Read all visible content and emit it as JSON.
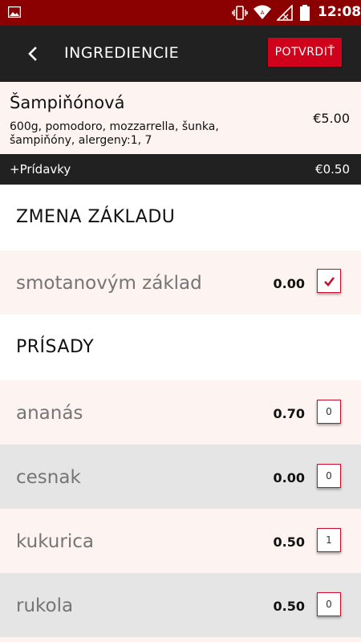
{
  "status_bar": {
    "time": "12:08",
    "icons": [
      "image-icon",
      "vibrate-icon",
      "wifi-icon",
      "signal-icon",
      "battery-icon"
    ]
  },
  "app_bar": {
    "title": "INGREDIENCIE",
    "confirm_label": "POTVRDIŤ"
  },
  "product": {
    "name": "Šampiňónová",
    "description": "600g, pomodoro, mozzarrella, šunka, šampiňóny, alergeny:1, 7",
    "price": "€5.00"
  },
  "extras": {
    "label": "+Prídavky",
    "value": "€0.50"
  },
  "sections": {
    "base_change": {
      "title": "ZMENA ZÁKLADU",
      "items": [
        {
          "name": "smotanovým základ",
          "price": "0.00",
          "checked": true
        }
      ]
    },
    "toppings": {
      "title": "PRÍSADY",
      "items": [
        {
          "name": "ananás",
          "price": "0.70",
          "qty": "0"
        },
        {
          "name": "cesnak",
          "price": "0.00",
          "qty": "0"
        },
        {
          "name": "kukurica",
          "price": "0.50",
          "qty": "1"
        },
        {
          "name": "rukola",
          "price": "0.50",
          "qty": "0"
        }
      ]
    }
  },
  "colors": {
    "status_bar": "#8b0000",
    "app_bar": "#212121",
    "accent": "#d0021b",
    "row_pink": "#fdf3f1",
    "row_grey": "#e5e5e5"
  }
}
